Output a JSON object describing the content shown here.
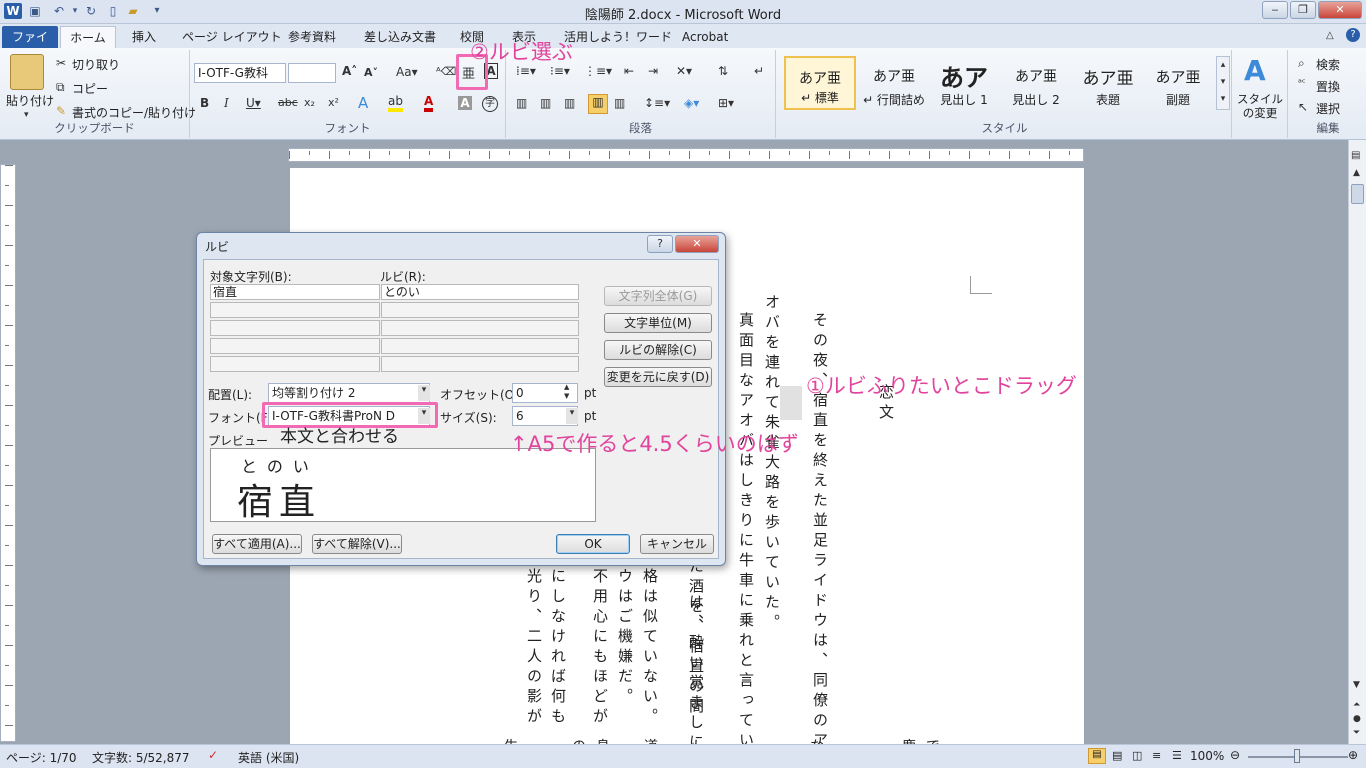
{
  "window": {
    "title": "陰陽師 2.docx - Microsoft Word",
    "app_icon": "W"
  },
  "quick_access": [
    "save-icon",
    "undo-icon",
    "redo-icon",
    "new-icon",
    "open-icon",
    "customize-icon"
  ],
  "tabs": [
    {
      "label": "ファイル",
      "type": "file"
    },
    {
      "label": "ホーム",
      "type": "active"
    },
    {
      "label": "挿入"
    },
    {
      "label": "ページ レイアウト"
    },
    {
      "label": "参考資料"
    },
    {
      "label": "差し込み文書"
    },
    {
      "label": "校閲"
    },
    {
      "label": "表示"
    },
    {
      "label": "活用しよう！ワード"
    },
    {
      "label": "Acrobat"
    }
  ],
  "ribbon": {
    "clipboard": {
      "label": "クリップボード",
      "paste": "貼り付け",
      "cut": "切り取り",
      "copy": "コピー",
      "format_painter": "書式のコピー/貼り付け"
    },
    "font": {
      "label": "フォント",
      "font_name": "I-OTF-G教科",
      "font_size": ""
    },
    "paragraph": {
      "label": "段落"
    },
    "styles": {
      "label": "スタイル",
      "items": [
        {
          "sample": "あア亜",
          "name": "↵ 標準"
        },
        {
          "sample": "あア亜",
          "name": "↵ 行間詰め"
        },
        {
          "sample": "あア",
          "name": "見出し 1"
        },
        {
          "sample": "あア亜",
          "name": "見出し 2"
        },
        {
          "sample": "あア亜",
          "name": "表題"
        },
        {
          "sample": "あア亜",
          "name": "副題"
        }
      ],
      "change_styles": "スタイルの変更"
    },
    "editing": {
      "label": "編集",
      "find": "検索",
      "replace": "置換",
      "select": "選択"
    }
  },
  "dialog": {
    "title": "ルビ",
    "col_target": "対象文字列(B):",
    "col_ruby": "ルビ(R):",
    "rows": [
      [
        "宿直",
        "とのい"
      ],
      [
        "",
        ""
      ],
      [
        "",
        ""
      ],
      [
        "",
        ""
      ],
      [
        "",
        ""
      ]
    ],
    "btn_whole": "文字列全体(G)",
    "btn_unit": "文字単位(M)",
    "btn_remove": "ルビの解除(C)",
    "btn_restore": "変更を元に戻す(D)",
    "align_label": "配置(L):",
    "align_value": "均等割り付け 2",
    "offset_label": "オフセット(O):",
    "offset_value": "0",
    "offset_unit": "pt",
    "font_label": "フォント(F):",
    "font_value": "I-OTF-G教科書ProN D",
    "size_label": "サイズ(S):",
    "size_value": "6",
    "size_unit": "pt",
    "preview_label": "プレビュー",
    "preview_ruby": "とのい",
    "preview_base": "宿直",
    "btn_apply_all": "すべて適用(A)...",
    "btn_remove_all": "すべて解除(V)...",
    "btn_ok": "OK",
    "btn_cancel": "キャンセル"
  },
  "annotations": {
    "step1": "①ルビふりたいとこドラッグ",
    "step2": "②ルビ選ぶ",
    "font_note": "本文と合わせる",
    "size_note": "↑A5で作ると4.5くらいのはず"
  },
  "document": {
    "columns": [
      "その夜、宿直を終えた並足ライドウは、同僚のア",
      "オバを連れて朱雀大路を歩いていた。",
      "真面目なアオバはしきりに牛車に乗れと言ってい",
      "",
      "た酒を、宿直の間",
      "は、酔い覚ましに",
      "格は似ていない。",
      "ウはご機嫌だ。",
      "不用心にもほどが",
      "にしなければ何も",
      "光り、二人の影が"
    ],
    "notes": [
      "恋文",
      "ぇ"
    ],
    "bottom_chars": [
      "生",
      "の",
      "息",
      "道",
      "し",
      "な",
      "鹿",
      "で"
    ]
  },
  "statusbar": {
    "page": "ページ: 1/70",
    "words": "文字数: 5/52,877",
    "language": "英語 (米国)",
    "zoom": "100%"
  }
}
